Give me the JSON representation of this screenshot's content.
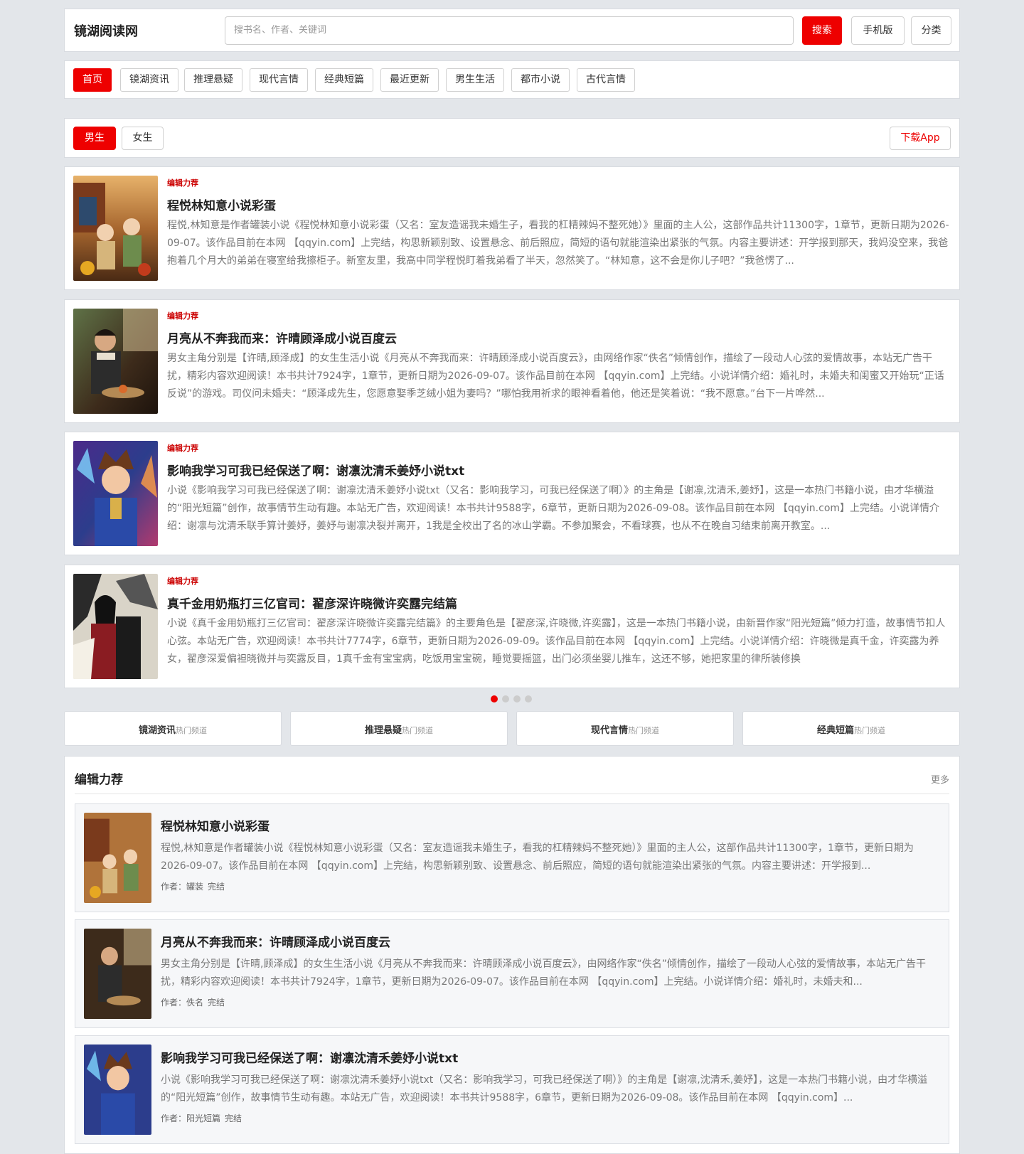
{
  "header": {
    "logo": "镜湖阅读网",
    "search_placeholder": "搜书名、作者、关键词",
    "search_button": "搜索",
    "mobile_button": "手机版",
    "category_button": "分类"
  },
  "nav": [
    "首页",
    "镜湖资讯",
    "推理悬疑",
    "现代言情",
    "经典短篇",
    "最近更新",
    "男生生活",
    "都市小说",
    "古代言情"
  ],
  "gender": {
    "male": "男生",
    "female": "女生",
    "download": "下载App"
  },
  "carousel": [
    {
      "tag": "编辑力荐",
      "title": "程悦林知意小说彩蛋",
      "desc": "程悦,林知意是作者罐装小说《程悦林知意小说彩蛋（又名：室友造谣我未婚生子，看我的杠精辣妈不整死她）》里面的主人公，这部作品共计11300字，1章节，更新日期为2026-09-07。该作品目前在本网 【qqyin.com】上完结，构思新颖别致、设置悬念、前后照应，简短的语句就能渲染出紧张的气氛。内容主要讲述：开学报到那天，我妈没空来，我爸抱着几个月大的弟弟在寝室给我擦柜子。新室友里，我高中同学程悦盯着我弟看了半天，忽然笑了。“林知意，这不会是你儿子吧？”我爸愣了..."
    },
    {
      "tag": "编辑力荐",
      "title": "月亮从不奔我而来：许晴顾泽成小说百度云",
      "desc": "男女主角分别是【许晴,顾泽成】的女生生活小说《月亮从不奔我而来：许晴顾泽成小说百度云》，由网络作家“佚名”倾情创作，描绘了一段动人心弦的爱情故事，本站无广告干扰，精彩内容欢迎阅读！本书共计7924字，1章节，更新日期为2026-09-07。该作品目前在本网 【qqyin.com】上完结。小说详情介绍：婚礼时，未婚夫和闺蜜又开始玩“正话反说”的游戏。司仪问未婚夫：“顾泽成先生，您愿意娶季芝绒小姐为妻吗？”哪怕我用祈求的眼神看着他，他还是笑着说：“我不愿意。”台下一片哗然..."
    },
    {
      "tag": "编辑力荐",
      "title": "影响我学习可我已经保送了啊：谢凛沈清禾姜妤小说txt",
      "desc": "小说《影响我学习可我已经保送了啊：谢凛沈清禾姜妤小说txt（又名：影响我学习，可我已经保送了啊）》的主角是【谢凛,沈清禾,姜妤】，这是一本热门书籍小说，由才华横溢的“阳光短篇”创作，故事情节生动有趣。本站无广告，欢迎阅读！本书共计9588字，6章节，更新日期为2026-09-08。该作品目前在本网 【qqyin.com】上完结。小说详情介绍：谢凛与沈清禾联手算计姜妤，姜妤与谢凛决裂并离开，1我是全校出了名的冰山学霸。不参加聚会，不看球赛，也从不在晚自习结束前离开教室。..."
    },
    {
      "tag": "编辑力荐",
      "title": "真千金用奶瓶打三亿官司：翟彦深许晓微许奕露完结篇",
      "desc": "小说《真千金用奶瓶打三亿官司：翟彦深许晓微许奕露完结篇》的主要角色是【翟彦深,许晓微,许奕露】，这是一本热门书籍小说，由新晋作家“阳光短篇”倾力打造，故事情节扣人心弦。本站无广告，欢迎阅读！本书共计7774字，6章节，更新日期为2026-09-09。该作品目前在本网 【qqyin.com】上完结。小说详情介绍：许晓微是真千金，许奕露为养女，翟彦深爱偏袒晓微并与奕露反目，1真千金有宝宝病，吃饭用宝宝碗，睡觉要摇篮，出门必须坐婴儿推车，这还不够，她把家里的律所装修换"
    }
  ],
  "channels": [
    {
      "name": "镜湖资讯",
      "sub": "热门频道"
    },
    {
      "name": "推理悬疑",
      "sub": "热门频道"
    },
    {
      "name": "现代言情",
      "sub": "热门频道"
    },
    {
      "name": "经典短篇",
      "sub": "热门频道"
    }
  ],
  "editor": {
    "title": "编辑力荐",
    "more": "更多",
    "items": [
      {
        "title": "程悦林知意小说彩蛋",
        "desc": "程悦,林知意是作者罐装小说《程悦林知意小说彩蛋（又名：室友造谣我未婚生子，看我的杠精辣妈不整死她）》里面的主人公，这部作品共计11300字，1章节，更新日期为2026-09-07。该作品目前在本网 【qqyin.com】上完结，构思新颖别致、设置悬念、前后照应，简短的语句就能渲染出紧张的气氛。内容主要讲述：开学报到...",
        "author_label": "作者：",
        "author": "罐装",
        "status": "完结"
      },
      {
        "title": "月亮从不奔我而来：许晴顾泽成小说百度云",
        "desc": "男女主角分别是【许晴,顾泽成】的女生生活小说《月亮从不奔我而来：许晴顾泽成小说百度云》，由网络作家“佚名”倾情创作，描绘了一段动人心弦的爱情故事，本站无广告干扰，精彩内容欢迎阅读！本书共计7924字，1章节，更新日期为2026-09-07。该作品目前在本网 【qqyin.com】上完结。小说详情介绍：婚礼时，未婚夫和...",
        "author_label": "作者：",
        "author": "佚名",
        "status": "完结"
      },
      {
        "title": "影响我学习可我已经保送了啊：谢凛沈清禾姜妤小说txt",
        "desc": "小说《影响我学习可我已经保送了啊：谢凛沈清禾姜妤小说txt（又名：影响我学习，可我已经保送了啊）》的主角是【谢凛,沈清禾,姜妤】，这是一本热门书籍小说，由才华横溢的“阳光短篇”创作，故事情节生动有趣。本站无广告，欢迎阅读！本书共计9588字，6章节，更新日期为2026-09-08。该作品目前在本网 【qqyin.com】...",
        "author_label": "作者：",
        "author": "阳光短篇",
        "status": "完结"
      }
    ]
  }
}
